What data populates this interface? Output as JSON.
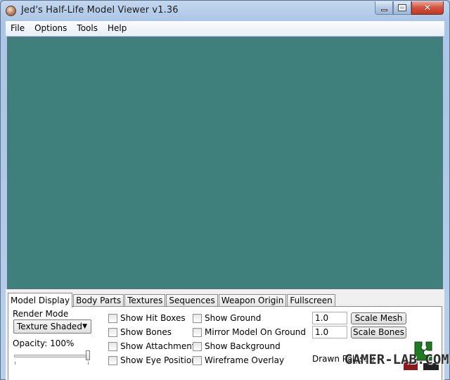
{
  "window": {
    "title": "Jed's Half-Life Model Viewer v1.36"
  },
  "menu": {
    "items": [
      "File",
      "Options",
      "Tools",
      "Help"
    ]
  },
  "viewport": {
    "background": "#3f7f7c"
  },
  "tabs": [
    "Model Display",
    "Body Parts",
    "Textures",
    "Sequences",
    "Weapon Origin",
    "Fullscreen"
  ],
  "model_display": {
    "render_mode_label": "Render Mode",
    "render_mode_value": "Texture Shaded",
    "opacity_label": "Opacity: 100%",
    "opacity_value": 100,
    "checkboxes_col1": [
      "Show Hit Boxes",
      "Show Bones",
      "Show Attachments",
      "Show Eye Position"
    ],
    "checkboxes_col2": [
      "Show Ground",
      "Mirror Model On Ground",
      "Show Background",
      "Wireframe Overlay"
    ],
    "scale_mesh_value": "1.0",
    "scale_mesh_label": "Scale Mesh",
    "scale_bones_value": "1.0",
    "scale_bones_label": "Scale Bones",
    "drawn_polys_label": "Drawn Polys: 0"
  },
  "watermark": {
    "text": "GAMER-LAB.COM"
  }
}
